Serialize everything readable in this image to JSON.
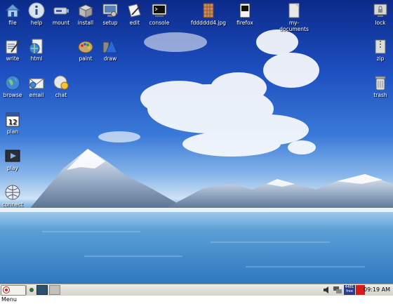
{
  "desktop": {
    "wallpaper": "mountain-lake-sky",
    "icons": [
      {
        "label": "file",
        "icon": "home-folder-icon"
      },
      {
        "label": "help",
        "icon": "info-icon"
      },
      {
        "label": "mount",
        "icon": "usb-drive-icon"
      },
      {
        "label": "install",
        "icon": "package-box-icon"
      },
      {
        "label": "setup",
        "icon": "monitor-settings-icon"
      },
      {
        "label": "edit",
        "icon": "pen-paper-icon"
      },
      {
        "label": "console",
        "icon": "terminal-icon"
      },
      {
        "label": "fdddddd4.jpg",
        "icon": "image-file-icon"
      },
      {
        "label": "firefox",
        "icon": "firefox-icon"
      },
      {
        "label": "my-documents",
        "icon": "document-icon"
      },
      {
        "label": "lock",
        "icon": "padlock-icon"
      },
      {
        "label": "write",
        "icon": "word-processor-icon"
      },
      {
        "label": "html",
        "icon": "web-page-icon"
      },
      {
        "label": "paint",
        "icon": "paint-palette-icon"
      },
      {
        "label": "draw",
        "icon": "draw-shapes-icon"
      },
      {
        "label": "zip",
        "icon": "archive-icon"
      },
      {
        "label": "browse",
        "icon": "globe-icon"
      },
      {
        "label": "email",
        "icon": "envelope-icon"
      },
      {
        "label": "chat",
        "icon": "chat-bubble-icon"
      },
      {
        "label": "trash",
        "icon": "trash-can-icon"
      },
      {
        "label": "plan",
        "icon": "calendar-icon"
      },
      {
        "label": "play",
        "icon": "media-player-icon"
      },
      {
        "label": "connect",
        "icon": "network-globe-icon"
      }
    ],
    "plan_date": "12"
  },
  "taskbar": {
    "menu_label": "Menu",
    "free_label_top": "4481",
    "free_label_bottom": "free",
    "clock": "09:19 AM"
  }
}
